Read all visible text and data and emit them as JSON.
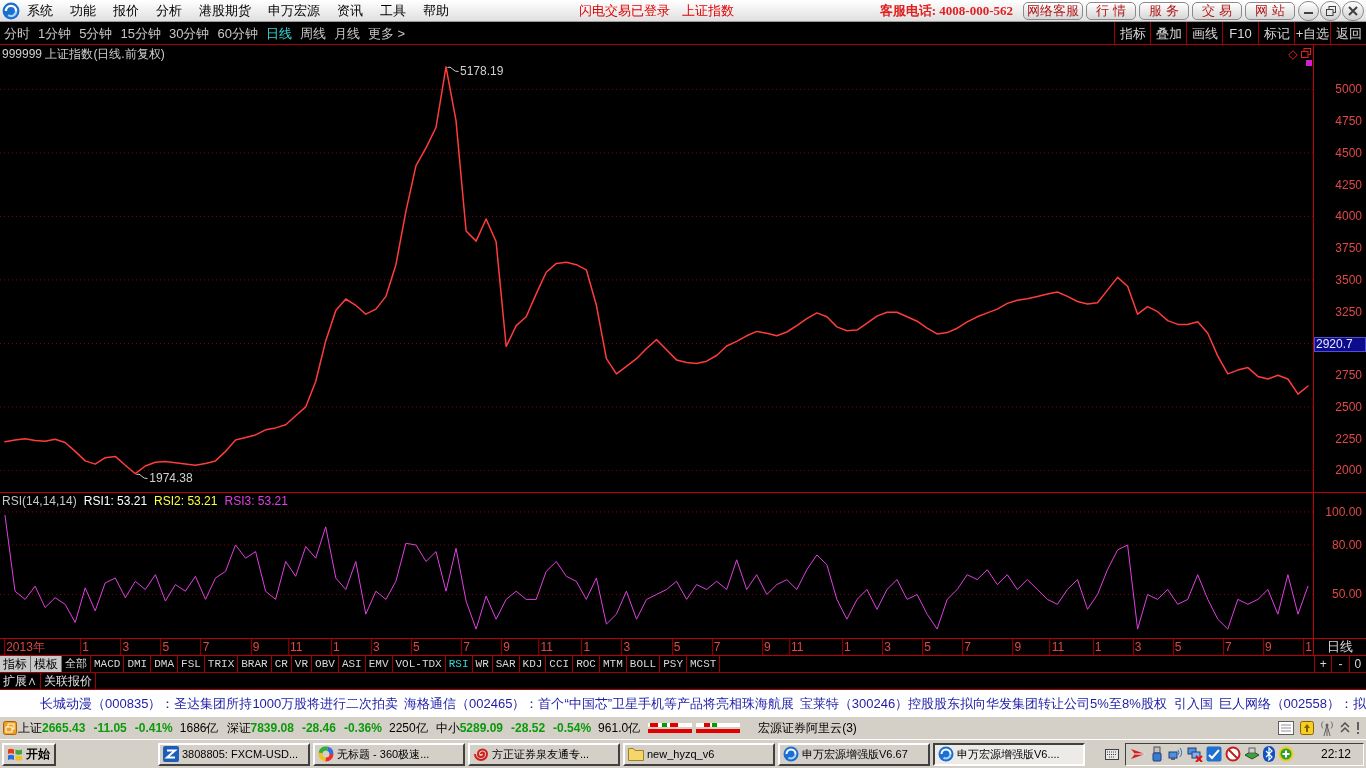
{
  "title_bar": {
    "menu": [
      "系统",
      "功能",
      "报价",
      "分析",
      "港股期货",
      "申万宏源",
      "资讯",
      "工具",
      "帮助"
    ],
    "login_status": "闪电交易已登录",
    "security": "上证指数",
    "hotline": "客服电话: 4008-000-562",
    "buttons": [
      "网络客服",
      "行 情",
      "服 务",
      "交 易",
      "网 站"
    ]
  },
  "period_tabs": [
    {
      "label": "分时",
      "selected": false
    },
    {
      "label": "1分钟",
      "selected": false
    },
    {
      "label": "5分钟",
      "selected": false
    },
    {
      "label": "15分钟",
      "selected": false
    },
    {
      "label": "30分钟",
      "selected": false
    },
    {
      "label": "60分钟",
      "selected": false
    },
    {
      "label": "日线",
      "selected": true
    },
    {
      "label": "周线",
      "selected": false
    },
    {
      "label": "月线",
      "selected": false
    },
    {
      "label": "更多 >",
      "selected": false
    }
  ],
  "tools": [
    "指标",
    "叠加",
    "画线",
    "F10",
    "标记",
    "+自选",
    "返回"
  ],
  "price_panel": {
    "title": "999999 上证指数(日线.前复权)",
    "cursor_value": "2920.7",
    "extreme_labels": [
      {
        "kind": "high",
        "text": "5178.19"
      },
      {
        "kind": "low",
        "text": "1974.38"
      }
    ],
    "chart_data": {
      "type": "line",
      "categories": [
        null,
        null,
        null,
        null,
        null,
        null,
        null,
        null,
        null,
        null,
        null,
        null,
        null,
        null,
        null,
        null,
        null,
        null,
        null,
        null,
        null,
        null,
        null,
        null,
        null,
        null,
        null,
        null,
        null,
        null,
        null,
        null,
        null,
        null,
        null,
        null,
        null,
        null,
        null,
        null,
        null,
        null,
        null,
        null,
        null,
        null,
        null,
        null,
        null,
        null,
        null,
        null,
        null,
        null,
        null,
        null,
        null,
        null,
        null,
        null,
        null,
        null,
        null,
        null,
        null,
        null,
        null,
        null,
        null,
        null,
        null,
        null,
        null,
        null,
        null,
        null,
        null,
        null,
        null,
        null,
        null,
        null,
        null,
        null,
        null,
        null,
        null,
        null,
        null,
        null,
        null,
        null,
        null,
        null,
        null,
        null,
        null,
        null,
        null,
        null,
        null,
        null,
        null,
        null,
        null,
        null,
        null,
        null,
        null,
        null,
        null,
        null,
        null,
        null,
        null,
        null,
        null,
        null,
        null,
        null,
        null,
        null,
        null,
        null,
        null,
        null,
        null,
        null,
        null,
        null,
        null
      ],
      "series": [
        {
          "color": "#ff3c3c",
          "values": [
            2225,
            2240,
            2250,
            2235,
            2230,
            2245,
            2220,
            2150,
            2075,
            2050,
            2100,
            2110,
            2040,
            1974,
            2035,
            2065,
            2070,
            2060,
            2050,
            2040,
            2055,
            2075,
            2150,
            2240,
            2260,
            2280,
            2320,
            2335,
            2360,
            2430,
            2500,
            2700,
            3020,
            3260,
            3350,
            3300,
            3230,
            3270,
            3370,
            3620,
            4040,
            4400,
            4540,
            4700,
            5178,
            4755,
            3885,
            3806,
            3980,
            3800,
            2976,
            3140,
            3210,
            3390,
            3560,
            3630,
            3640,
            3620,
            3580,
            3300,
            2880,
            2760,
            2820,
            2880,
            2960,
            3030,
            2950,
            2870,
            2850,
            2842,
            2860,
            2905,
            2980,
            3016,
            3060,
            3095,
            3080,
            3060,
            3090,
            3140,
            3195,
            3240,
            3210,
            3130,
            3100,
            3105,
            3160,
            3215,
            3245,
            3245,
            3210,
            3175,
            3120,
            3075,
            3085,
            3120,
            3170,
            3210,
            3240,
            3270,
            3315,
            3340,
            3352,
            3370,
            3390,
            3405,
            3370,
            3330,
            3310,
            3320,
            3420,
            3520,
            3450,
            3230,
            3290,
            3250,
            3180,
            3150,
            3150,
            3170,
            3080,
            2900,
            2760,
            2790,
            2810,
            2740,
            2720,
            2750,
            2720,
            2600,
            2665
          ]
        }
      ],
      "ylim": [
        1830,
        5350
      ],
      "yticks": [
        2000,
        2250,
        2500,
        2750,
        3250,
        3500,
        3750,
        4000,
        4250,
        4500,
        4750,
        5000
      ],
      "grid": true
    }
  },
  "rsi_panel": {
    "name": "RSI(14,14,14)",
    "legend": [
      {
        "text": "RSI1: 53.21",
        "color": "#ffffff"
      },
      {
        "text": "RSI2: 53.21",
        "color": "#ffff40"
      },
      {
        "text": "RSI3: 53.21",
        "color": "#e040e0"
      }
    ],
    "period": "日线",
    "chart_data": {
      "type": "line",
      "categories": [
        null,
        null,
        "2013年",
        null,
        null,
        null,
        null,
        null,
        "1",
        null,
        null,
        null,
        "3",
        null,
        null,
        null,
        "5",
        null,
        null,
        null,
        "7",
        null,
        null,
        null,
        null,
        "9",
        null,
        null,
        null,
        "11",
        null,
        null,
        null,
        "1",
        null,
        null,
        null,
        "3",
        null,
        null,
        null,
        "5",
        null,
        null,
        null,
        null,
        "7",
        null,
        null,
        null,
        "9",
        null,
        null,
        null,
        "11",
        null,
        null,
        null,
        "1",
        null,
        null,
        null,
        "3",
        null,
        null,
        null,
        null,
        "5",
        null,
        null,
        null,
        "7",
        null,
        null,
        null,
        null,
        "9",
        null,
        null,
        "11",
        null,
        null,
        null,
        null,
        "1",
        null,
        null,
        null,
        "3",
        null,
        null,
        null,
        "5",
        null,
        null,
        null,
        "7",
        null,
        null,
        null,
        null,
        "9",
        null,
        null,
        null,
        "11",
        null,
        null,
        null,
        "1",
        null,
        null,
        null,
        "3",
        null,
        null,
        null,
        "5",
        null,
        null,
        null,
        null,
        "7",
        null,
        null,
        null,
        "9",
        null,
        null,
        null,
        "1"
      ],
      "series": [
        {
          "color": "#e040e0",
          "values": [
            98,
            52,
            47,
            55,
            42,
            48,
            44,
            33,
            54,
            40,
            57,
            60,
            48,
            58,
            53,
            62,
            46,
            56,
            52,
            61,
            47,
            60,
            64,
            80,
            72,
            76,
            52,
            47,
            70,
            61,
            79,
            72,
            91,
            60,
            53,
            70,
            38,
            52,
            47,
            58,
            81,
            80,
            70,
            76,
            52,
            78,
            46,
            29,
            49,
            35,
            47,
            52,
            47,
            47,
            64,
            70,
            61,
            58,
            47,
            60,
            32,
            38,
            52,
            35,
            47,
            50,
            53,
            58,
            47,
            56,
            53,
            58,
            53,
            71,
            53,
            62,
            50,
            56,
            59,
            53,
            65,
            74,
            68,
            47,
            35,
            47,
            53,
            41,
            53,
            59,
            47,
            50,
            38,
            29,
            47,
            53,
            62,
            59,
            65,
            56,
            62,
            53,
            59,
            53,
            47,
            44,
            53,
            59,
            41,
            50,
            65,
            77,
            80,
            29,
            50,
            47,
            53,
            44,
            47,
            62,
            47,
            35,
            29,
            47,
            44,
            47,
            53,
            38,
            62,
            38,
            55
          ]
        }
      ],
      "ylim": [
        23.6,
        111.5
      ],
      "yticks": [
        {
          "value": 50,
          "label": "50.00"
        },
        {
          "value": 80,
          "label": "80.00"
        },
        {
          "value": 100,
          "label": "100.00"
        }
      ],
      "grid": true
    }
  },
  "indicator_bar": {
    "buttons": [
      "指标",
      "模板"
    ],
    "indicators": [
      {
        "label": "全部",
        "selected": false
      },
      {
        "label": "MACD",
        "selected": false
      },
      {
        "label": "DMI",
        "selected": false
      },
      {
        "label": "DMA",
        "selected": false
      },
      {
        "label": "FSL",
        "selected": false
      },
      {
        "label": "TRIX",
        "selected": false
      },
      {
        "label": "BRAR",
        "selected": false
      },
      {
        "label": "CR",
        "selected": false
      },
      {
        "label": "VR",
        "selected": false
      },
      {
        "label": "OBV",
        "selected": false
      },
      {
        "label": "ASI",
        "selected": false
      },
      {
        "label": "EMV",
        "selected": false
      },
      {
        "label": "VOL-TDX",
        "selected": false
      },
      {
        "label": "RSI",
        "selected": true
      },
      {
        "label": "WR",
        "selected": false
      },
      {
        "label": "SAR",
        "selected": false
      },
      {
        "label": "KDJ",
        "selected": false
      },
      {
        "label": "CCI",
        "selected": false
      },
      {
        "label": "ROC",
        "selected": false
      },
      {
        "label": "MTM",
        "selected": false
      },
      {
        "label": "BOLL",
        "selected": false
      },
      {
        "label": "PSY",
        "selected": false
      },
      {
        "label": "MCST",
        "selected": false
      }
    ],
    "zoom_buttons": [
      "+",
      "-",
      "0"
    ]
  },
  "extension_bar": [
    "扩展∧",
    "关联报价"
  ],
  "news_ticker": [
    "长城动漫（000835）：圣达集团所持1000万股将进行二次拍卖",
    "海格通信（002465）：首个“中国芯”卫星手机等产品将亮相珠海航展",
    "宝莱特（300246）控股股东拟向华发集团转让公司5%至8%股权  引入国",
    "巨人网络（002558）：拟"
  ],
  "status_bar": {
    "indices": [
      {
        "name": "上证",
        "value": "2665.43",
        "change": "-11.05",
        "percent": "-0.41%",
        "amount": "1686亿",
        "falling": true
      },
      {
        "name": "深证",
        "value": "7839.08",
        "change": "-28.46",
        "percent": "-0.36%",
        "amount": "2250亿",
        "falling": true
      },
      {
        "name": "中小",
        "value": "5289.09",
        "change": "-28.52",
        "percent": "-0.54%",
        "amount": "961.0亿",
        "falling": true
      }
    ],
    "server": "宏源证券阿里云(3)"
  },
  "taskbar": {
    "start": "开始",
    "tasks": [
      {
        "label": "3808805: FXCM-USD...",
        "kind": "square",
        "selected": false
      },
      {
        "label": "无标题 - 360极速...",
        "kind": "ring",
        "selected": false
      },
      {
        "label": "方正证券泉友通专...",
        "kind": "spiral",
        "selected": false
      },
      {
        "label": "new_hyzq_v6",
        "kind": "folder",
        "selected": false
      },
      {
        "label": "申万宏源增强版V6.67",
        "kind": "swirl",
        "selected": false
      },
      {
        "label": "申万宏源增强版V6....",
        "kind": "swirl",
        "selected": true
      }
    ],
    "clock": "22:12"
  }
}
